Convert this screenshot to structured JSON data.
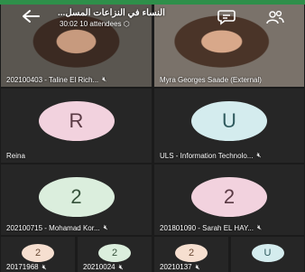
{
  "colors": {
    "accent_bar": "#2e8f4a",
    "avatar_pink": "#f2d2de",
    "avatar_teal": "#d4ecee",
    "avatar_green": "#dbeedd",
    "avatar_peach": "#f6dfd0"
  },
  "header": {
    "title": "النساء في النزاعات المسل...",
    "timer": "30:02",
    "attendees": "10 attendees",
    "back_icon": "arrow-left-icon",
    "chat_icon": "chat-icon",
    "people_icon": "people-icon"
  },
  "tiles": [
    {
      "name": "202100403 - Taline El Rich...",
      "type": "video",
      "muted": true
    },
    {
      "name": "Myra Georges Saade (External)",
      "type": "video",
      "muted": true
    },
    {
      "name": "Reina",
      "initial": "R",
      "type": "avatar",
      "muted": false
    },
    {
      "name": "ULS - Information Technolo...",
      "initial": "U",
      "type": "avatar",
      "muted": true
    },
    {
      "name": "202100715 - Mohamad Kor...",
      "initial": "2",
      "type": "avatar",
      "muted": true
    },
    {
      "name": "201801090 - Sarah EL HAY...",
      "initial": "2",
      "type": "avatar",
      "muted": true
    }
  ],
  "strip": [
    {
      "name": "20171968",
      "initial": "2",
      "muted": true
    },
    {
      "name": "20210024",
      "initial": "2",
      "muted": true
    },
    {
      "name": "20210137",
      "initial": "2",
      "muted": true
    },
    {
      "name": "",
      "initial": "U",
      "muted": false
    }
  ]
}
